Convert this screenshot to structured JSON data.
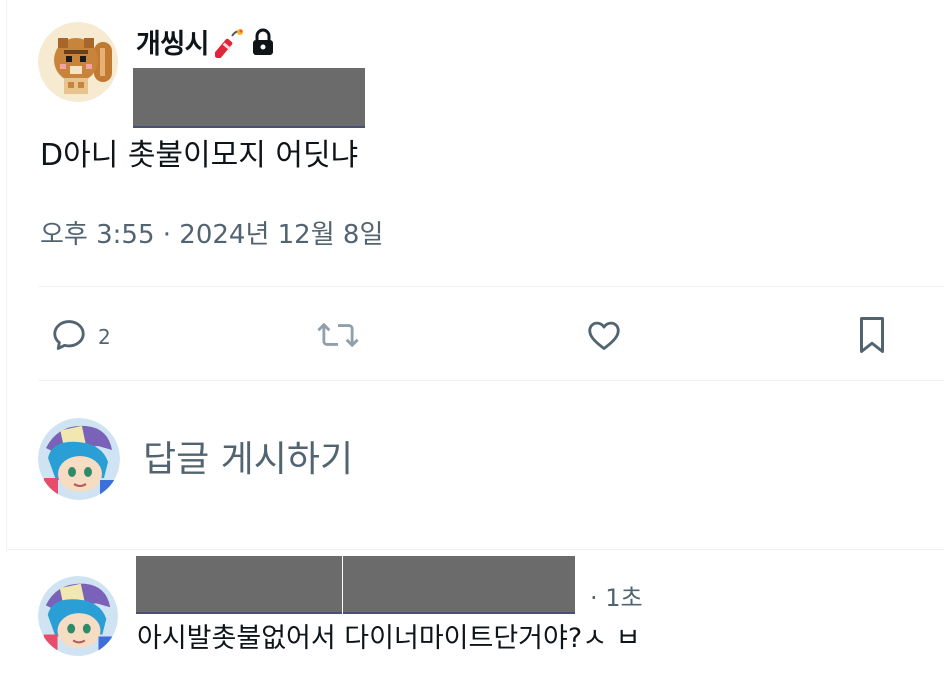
{
  "tweet": {
    "author_name": "개씽시",
    "text": "D아니 촛불이모지 어딧냐",
    "timestamp": "오후 3:55 · 2024년 12월 8일"
  },
  "actions": {
    "reply_count": "2"
  },
  "compose": {
    "placeholder": "답글 게시하기"
  },
  "reply": {
    "time": "· 1초",
    "text": "아시발촛불없어서 다이너마이트단거야?ㅅ ㅂ"
  },
  "icons": {
    "author_badge": "dynamite-icon",
    "protected": "lock-icon",
    "reply": "comment-icon",
    "retweet": "retweet-icon",
    "like": "heart-icon",
    "bookmark": "bookmark-icon"
  },
  "colors": {
    "text_primary": "#0f1419",
    "text_secondary": "#536471",
    "divider": "#eff3f4",
    "redaction": "#6b6b6b"
  }
}
